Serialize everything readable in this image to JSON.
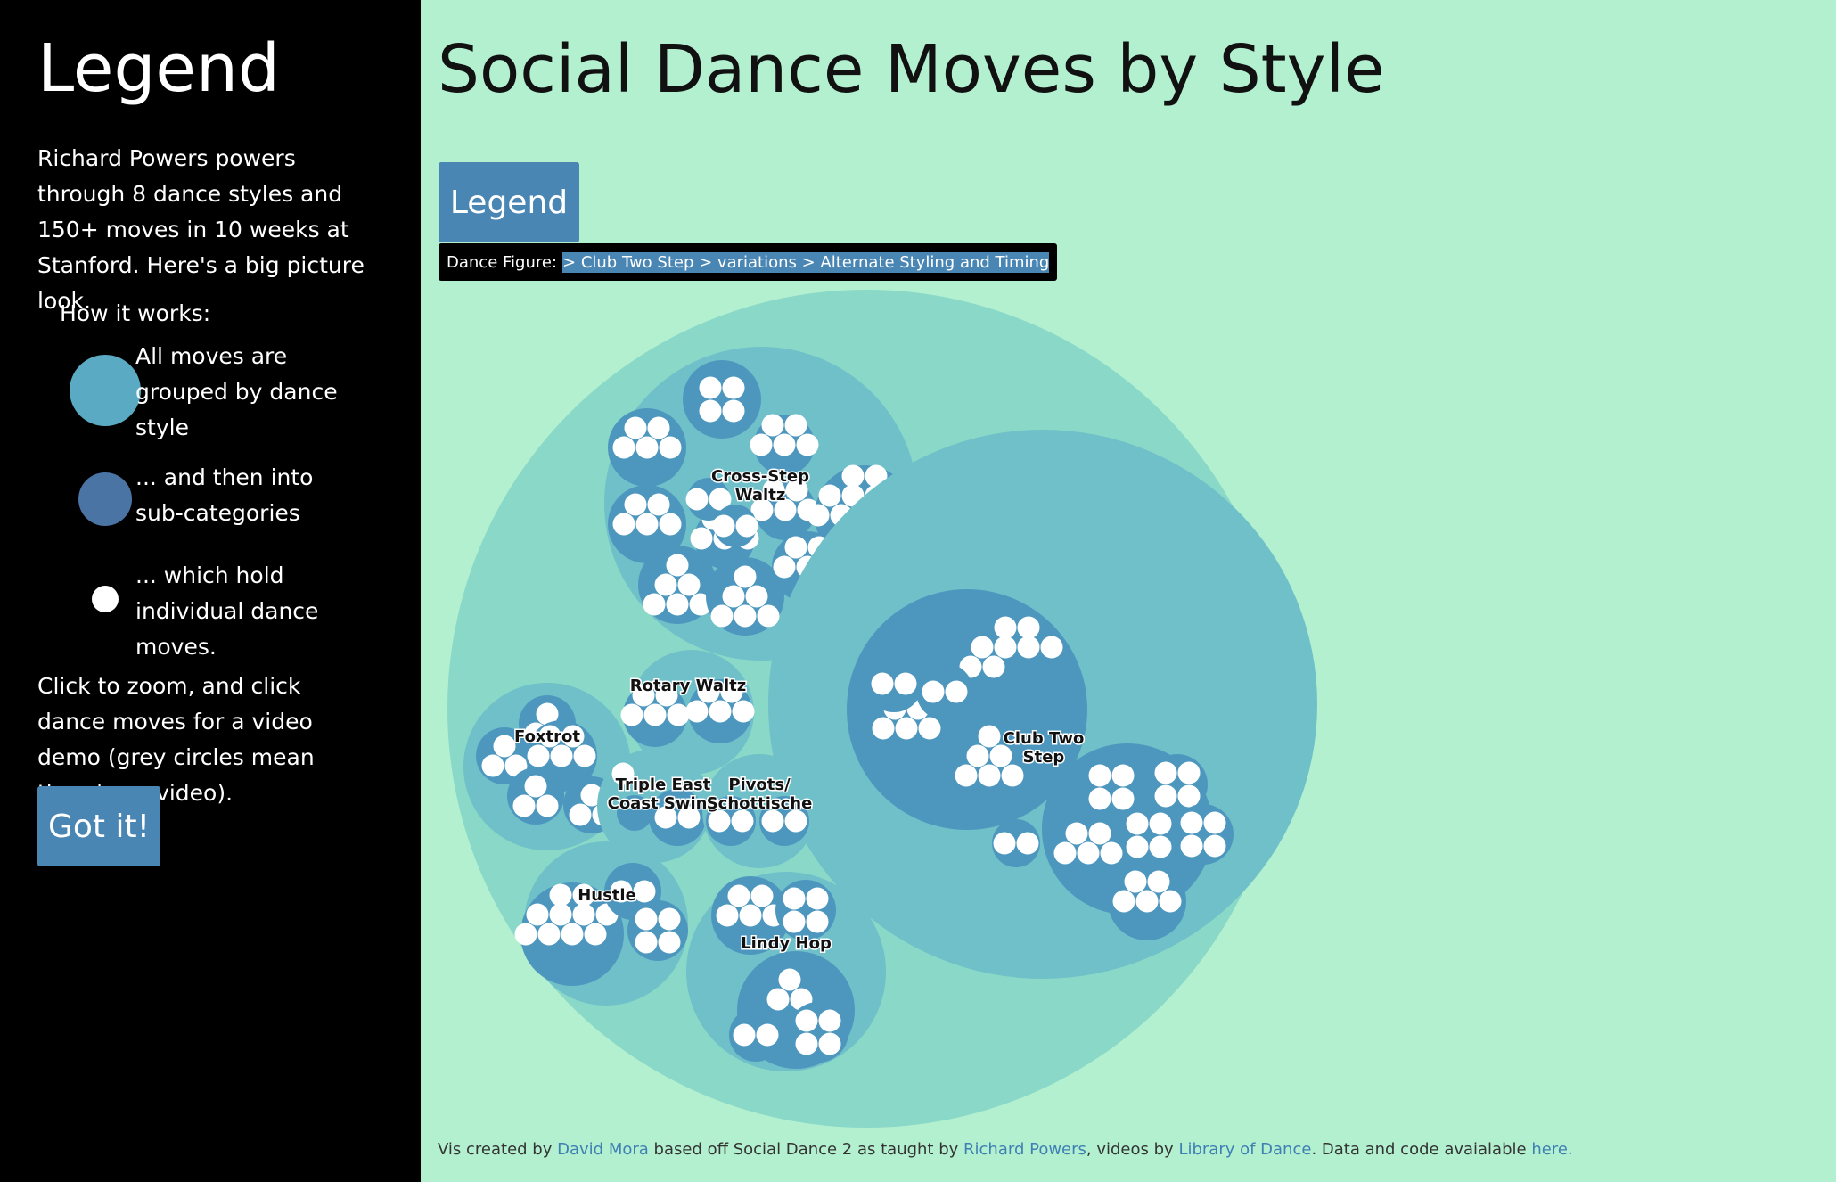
{
  "sidebar": {
    "title": "Legend",
    "intro": "Richard Powers powers through 8 dance styles and 150+ moves in 10 weeks at Stanford. Here's a big picture look.",
    "how_heading": "How it works:",
    "items": [
      {
        "text": "All moves are grouped by dance style",
        "color": "#5aaac4"
      },
      {
        "text": "... and then into sub-categories",
        "color": "#4a74a4"
      },
      {
        "text": "... which hold individual dance moves.",
        "color": "#ffffff"
      }
    ],
    "outro": "Click to zoom, and click dance moves for a video demo (grey circles mean there's no video).",
    "button_label": "Got it!"
  },
  "main": {
    "title": "Social Dance Moves by Style",
    "legend_button": "Legend",
    "breadcrumb_label": "Dance Figure:",
    "breadcrumb_path": "> Club Two Step > variations > Alternate Styling and Timing"
  },
  "chart": {
    "labels": {
      "cross_step_waltz": "Cross-Step Waltz",
      "rotary_waltz": "Rotary Waltz",
      "foxtrot": "Foxtrot",
      "triple_east_coast_swing": "Triple East Coast Swing",
      "pivots_schottische": "Pivots/ Schottische",
      "hustle": "Hustle",
      "lindy_hop": "Lindy Hop",
      "club_two_step": "Club Two Step"
    },
    "colors": {
      "page_bg": "#b3f0d0",
      "root": "#8ad8c8",
      "style": "#6fc0c8",
      "subcategory": "#4d97bf",
      "move": "#ffffff"
    }
  },
  "footer": {
    "t1": "Vis created by",
    "author": "David Mora",
    "t2": "based off Social Dance 2 as taught by",
    "teacher": "Richard Powers",
    "t3": ", videos by",
    "videos": "Library of Dance",
    "t4": ". Data and code avaialable",
    "here": "here."
  }
}
